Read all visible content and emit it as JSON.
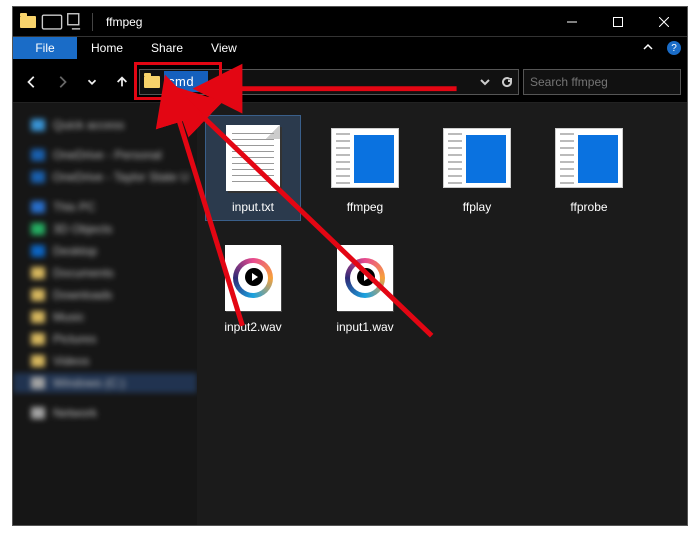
{
  "titlebar": {
    "title": "ffmpeg"
  },
  "ribbon": {
    "file": "File",
    "tabs": [
      "Home",
      "Share",
      "View"
    ]
  },
  "nav": {
    "address_value": "cmd",
    "search_placeholder": "Search ffmpeg"
  },
  "sidebar": {
    "quick_access": "Quick access",
    "onedrive": "OneDrive - Personal",
    "onedrive2": "OneDrive - Taylor State U",
    "this_pc": "This PC",
    "children": [
      "3D Objects",
      "Desktop",
      "Documents",
      "Downloads",
      "Music",
      "Pictures",
      "Videos",
      "Windows (C:)"
    ],
    "network": "Network"
  },
  "files": [
    {
      "name": "input.txt",
      "kind": "txt",
      "selected": true
    },
    {
      "name": "ffmpeg",
      "kind": "exe",
      "selected": false
    },
    {
      "name": "ffplay",
      "kind": "exe",
      "selected": false
    },
    {
      "name": "ffprobe",
      "kind": "exe",
      "selected": false
    },
    {
      "name": "input2.wav",
      "kind": "wav",
      "selected": false
    },
    {
      "name": "input1.wav",
      "kind": "wav",
      "selected": false
    }
  ]
}
